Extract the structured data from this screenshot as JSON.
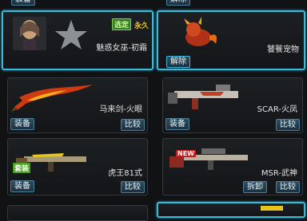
{
  "top_left_button": "装备",
  "top_right_button": "解除",
  "cards": {
    "character": {
      "name": "魅惑女巫-初霜",
      "badge_selected": "选定",
      "badge_duration": "永久"
    },
    "pet": {
      "name": "饕餮宠物",
      "button": "解除"
    },
    "sword": {
      "name": "马来剑-火眼",
      "equip": "装备",
      "compare": "比较"
    },
    "scar": {
      "name": "SCAR-火凤",
      "equip": "装备",
      "compare": "比较"
    },
    "rifle": {
      "name": "虎王81式",
      "tag": "套装",
      "equip": "装备",
      "compare": "比较"
    },
    "msr": {
      "name": "MSR-武神",
      "tag": "NEW",
      "remove": "拆卸",
      "compare": "比较"
    }
  },
  "colors": {
    "selected_border": "#3fb8d8",
    "accent_yellow": "#e8c51a"
  }
}
